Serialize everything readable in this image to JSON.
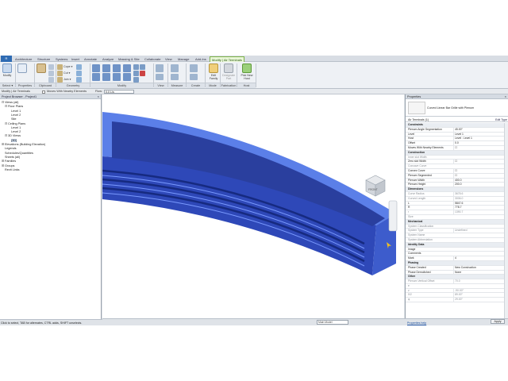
{
  "app_button": "R",
  "ribbon_tabs": [
    "Architecture",
    "Structure",
    "Systems",
    "Insert",
    "Annotate",
    "Analyze",
    "Massing & Site",
    "Collaborate",
    "View",
    "Manage",
    "Add-Ins",
    "Modify | Air Terminals"
  ],
  "ribbon": {
    "modify_label": "Modify",
    "select_label": "Select ▾",
    "panels": [
      "Properties",
      "Clipboard",
      "Geometry",
      "Modify",
      "View",
      "Measure",
      "Create",
      "Mode",
      "Fabrication",
      "Host"
    ],
    "geometry_small": [
      "Cope ▾",
      "Cut ▾",
      "Join ▾"
    ],
    "mode_label": "Edit Family",
    "fab_label": "Designate Part",
    "host_label": "Pick New Host"
  },
  "options_bar": {
    "context": "Modify | Air Terminals",
    "moves_label": "Moves With Nearby Elements",
    "flow_label": "Flow:",
    "flow_value": "0.0 L/s"
  },
  "project_browser": {
    "title": "Project Browser - Project1",
    "items": [
      {
        "label": "Views (all)",
        "toggle": "⊟"
      },
      {
        "label": "Floor Plans",
        "toggle": "⊟"
      },
      {
        "label": "Level 1",
        "toggle": ""
      },
      {
        "label": "Level 2",
        "toggle": ""
      },
      {
        "label": "Site",
        "toggle": ""
      },
      {
        "label": "Ceiling Plans",
        "toggle": "⊟"
      },
      {
        "label": "Level 1",
        "toggle": ""
      },
      {
        "label": "Level 2",
        "toggle": ""
      },
      {
        "label": "3D Views",
        "toggle": "⊟"
      },
      {
        "label": "{3D}",
        "toggle": ""
      },
      {
        "label": "Elevations (Building Elevation)",
        "toggle": "⊞"
      },
      {
        "label": "Legends",
        "toggle": ""
      },
      {
        "label": "Schedules/Quantities",
        "toggle": ""
      },
      {
        "label": "Sheets (all)",
        "toggle": ""
      },
      {
        "label": "Families",
        "toggle": "⊞"
      },
      {
        "label": "Groups",
        "toggle": "⊞"
      },
      {
        "label": "Revit Links",
        "toggle": ""
      }
    ]
  },
  "viewcube_label": "FRONT",
  "view_scale": "1 : 100",
  "status_text": "Click to select, TAB for alternates, CTRL adds, SHIFT unselects.",
  "main_model": "Main Model",
  "properties": {
    "title": "Properties",
    "type_name": "Curved Linear Bar Grille with Plenum",
    "instance_label": "Air Terminals (1)",
    "edit_type": "Edit Type",
    "rows": [
      {
        "k": "Constraints",
        "v": "",
        "hdr": true
      },
      {
        "k": "Plenum Angle Segmentation",
        "v": "45.00°"
      },
      {
        "k": "Level",
        "v": "Level 1"
      },
      {
        "k": "Host",
        "v": "Level : Level 1"
      },
      {
        "k": "Offset",
        "v": "0.0"
      },
      {
        "k": "Moves With Nearby Elements",
        "v": "☐"
      },
      {
        "k": "Construction",
        "v": "",
        "hdr": true
      },
      {
        "k": "Inner slot Width",
        "v": "",
        "ro": true
      },
      {
        "k": "Zero slot Width",
        "v": "☐"
      },
      {
        "k": "Concave Curve",
        "v": "",
        "ro": true
      },
      {
        "k": "Convex Curve",
        "v": "☐"
      },
      {
        "k": "Plenum Segmented",
        "v": "☐"
      },
      {
        "k": "Plenum Width",
        "v": "400.0"
      },
      {
        "k": "Plenum Height",
        "v": "200.0"
      },
      {
        "k": "Dimensions",
        "v": "",
        "hdr": true
      },
      {
        "k": "Curve Radius",
        "v": "3678.6",
        "ro": true
      },
      {
        "k": "Curved Length",
        "v": "3006.0",
        "ro": true
      },
      {
        "k": "L",
        "v": "5847.6"
      },
      {
        "k": "R",
        "v": "778.7"
      },
      {
        "k": "r",
        "v": "1390.7",
        "ro": true
      },
      {
        "k": "Size",
        "v": "",
        "ro": true
      },
      {
        "k": "Mechanical",
        "v": "",
        "hdr": true
      },
      {
        "k": "System Classification",
        "v": "",
        "ro": true
      },
      {
        "k": "System Type",
        "v": "Undefined",
        "ro": true
      },
      {
        "k": "System Name",
        "v": "",
        "ro": true
      },
      {
        "k": "System Abbreviation",
        "v": "",
        "ro": true
      },
      {
        "k": "Identity Data",
        "v": "",
        "hdr": true
      },
      {
        "k": "Image",
        "v": ""
      },
      {
        "k": "Comments",
        "v": ""
      },
      {
        "k": "Mark",
        "v": "4"
      },
      {
        "k": "Phasing",
        "v": "",
        "hdr": true
      },
      {
        "k": "Phase Created",
        "v": "New Construction"
      },
      {
        "k": "Phase Demolished",
        "v": "None"
      },
      {
        "k": "Other",
        "v": "",
        "hdr": true
      },
      {
        "k": "Plenum Vertical Offset",
        "v": "70.0",
        "ro": true
      },
      {
        "k": "e",
        "v": "",
        "ro": true
      },
      {
        "k": "z",
        "v": "-90.00°",
        "ro": true
      },
      {
        "k": "δ/2",
        "v": "89.00°",
        "ro": true
      },
      {
        "k": "φ",
        "v": "29.00°",
        "ro": true
      }
    ],
    "help_link": "Properties help",
    "apply": "Apply"
  },
  "colors": {
    "duct_dark": "#2a3f9e",
    "duct_mid": "#3d5ccc",
    "duct_light": "#5b7fe8",
    "ribbon_accent": "#7fb24a"
  }
}
